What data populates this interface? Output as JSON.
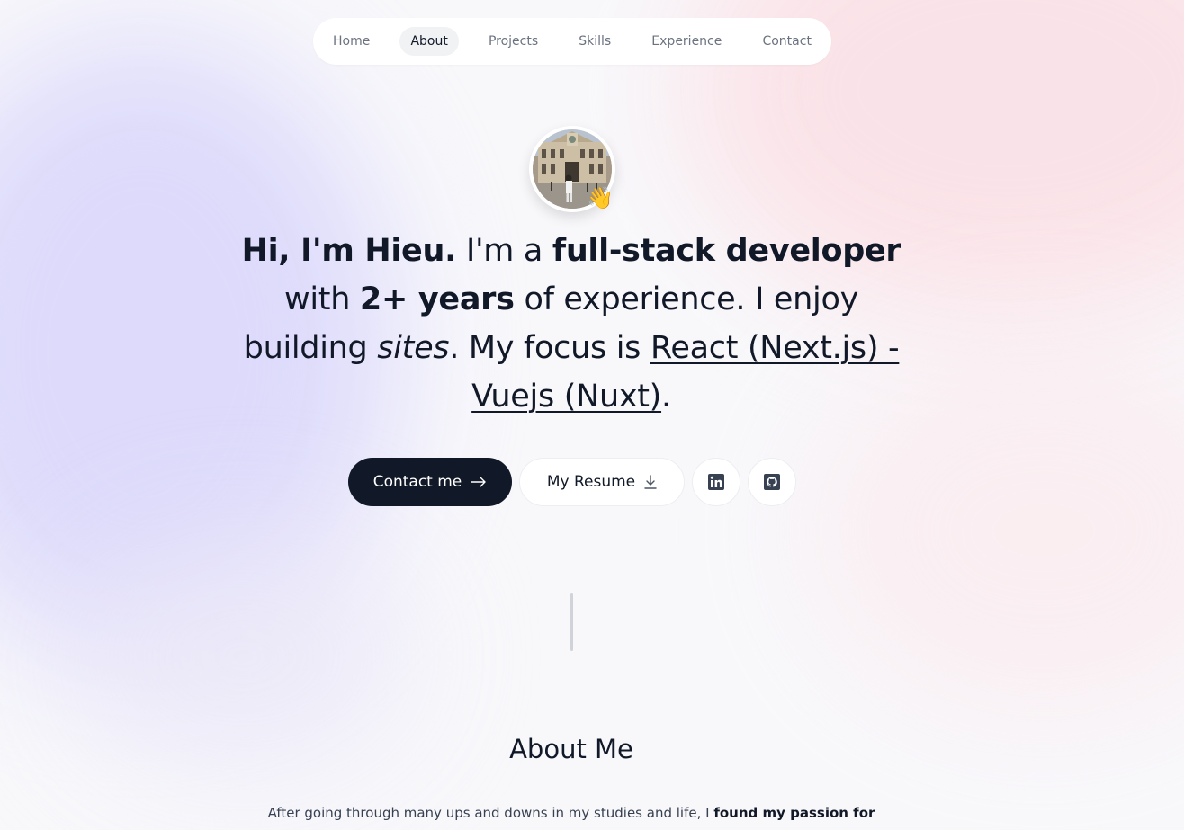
{
  "nav": {
    "items": [
      {
        "label": "Home"
      },
      {
        "label": "About"
      },
      {
        "label": "Projects"
      },
      {
        "label": "Skills"
      },
      {
        "label": "Experience"
      },
      {
        "label": "Contact"
      }
    ],
    "active": "About"
  },
  "hero": {
    "avatar_icon": "profile-photo",
    "wave_emoji": "👋",
    "intro_bold": "Hi, I'm Hieu.",
    "t1": " I'm a ",
    "role_bold": "full-stack developer",
    "t2": " with ",
    "years_bold": "2+ years",
    "t3": " of experience. I enjoy building ",
    "sites_italic": "sites",
    "t4": ". My focus is ",
    "focus_link": "React (Next.js) - Vuejs (Nuxt)",
    "t5": "."
  },
  "actions": {
    "contact_label": "Contact me",
    "contact_icon": "arrow-right-icon",
    "resume_label": "My Resume",
    "resume_icon": "download-icon",
    "linkedin_icon": "linkedin-icon",
    "github_icon": "github-icon"
  },
  "about": {
    "title": "About Me",
    "text_start": "After going through many ups and downs in my studies and life, I ",
    "text_bold": "found my passion for"
  },
  "colors": {
    "dark": "#111827",
    "muted": "#6b7280",
    "lavender": "#dcd9fb",
    "pink": "#fbe1e6"
  }
}
